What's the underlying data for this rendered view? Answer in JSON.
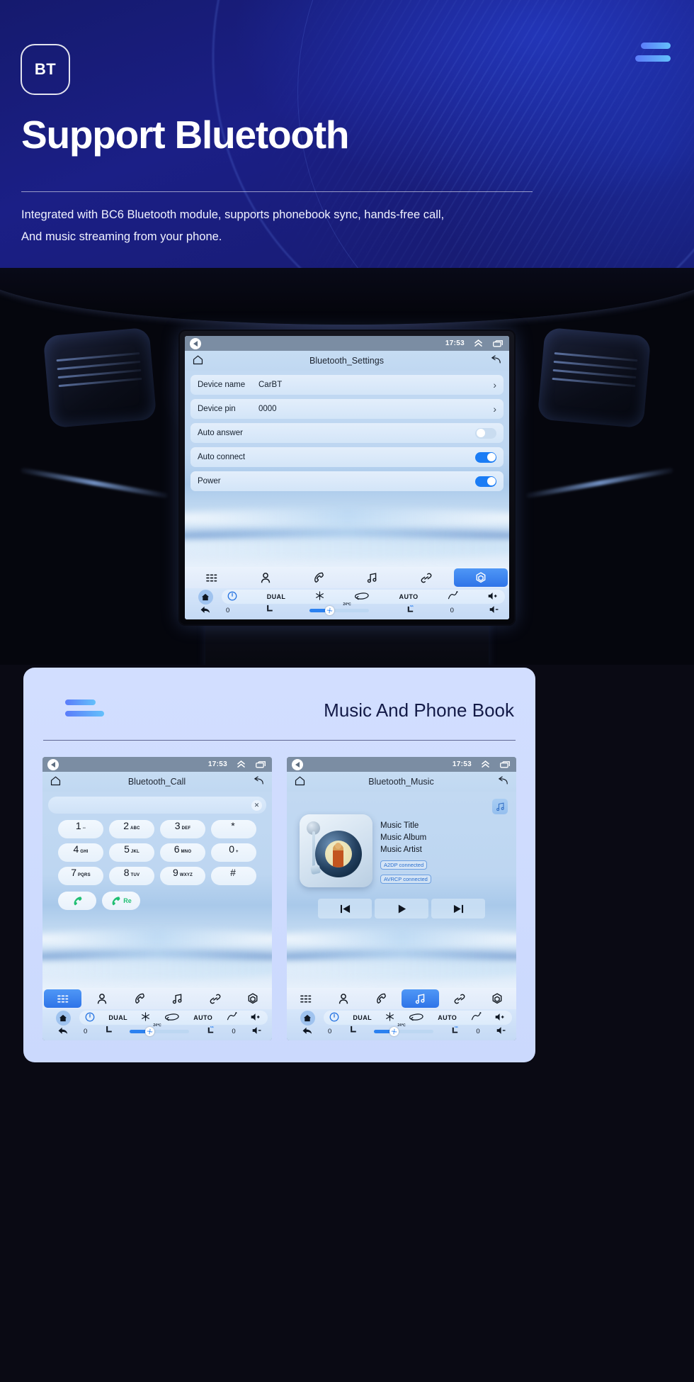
{
  "hero": {
    "badge": "BT",
    "title": "Support Bluetooth",
    "desc_line1": "Integrated with BC6 Bluetooth module, supports phonebook sync, hands-free call,",
    "desc_line2": "And music streaming from your phone.",
    "menu_icon": "hamburger-icon",
    "accent_start": "#5b7cfa",
    "accent_end": "#63c0fb"
  },
  "main_screen": {
    "statusbar": {
      "back_icon": "back-arrow-icon",
      "time": "17:53",
      "chevron_icon": "chevron-up-icon",
      "recents_icon": "recent-apps-icon"
    },
    "app_title": "Bluetooth_Settings",
    "home_icon": "home-icon",
    "back_icon": "undo-back-icon",
    "settings_rows": [
      {
        "label": "Device name",
        "value": "CarBT",
        "control": "chevron",
        "chevron": "›"
      },
      {
        "label": "Device pin",
        "value": "0000",
        "control": "chevron",
        "chevron": "›"
      },
      {
        "label": "Auto answer",
        "value": "",
        "control": "toggle",
        "state": "off"
      },
      {
        "label": "Auto connect",
        "value": "",
        "control": "toggle",
        "state": "on"
      },
      {
        "label": "Power",
        "value": "",
        "control": "toggle",
        "state": "on"
      }
    ],
    "nav": [
      {
        "name": "dialpad",
        "icon": "dialpad-icon",
        "active": false
      },
      {
        "name": "contacts",
        "icon": "person-icon",
        "active": false
      },
      {
        "name": "call",
        "icon": "phone-icon",
        "active": false
      },
      {
        "name": "music",
        "icon": "music-note-icon",
        "active": false
      },
      {
        "name": "link",
        "icon": "link-icon",
        "active": false
      },
      {
        "name": "settings",
        "icon": "settings-hexagon-icon",
        "active": true
      }
    ],
    "climate": {
      "power_icon": "power-icon",
      "dual": "DUAL",
      "snow_icon": "snowflake-icon",
      "recirc_icon": "recirculate-icon",
      "auto": "AUTO",
      "defrost_icon": "defrost-icon",
      "vol_up_icon": "volume-up-icon",
      "vol_down_icon": "volume-down-icon",
      "back_icon": "back-arrow-icon",
      "home_icon": "home-icon",
      "temp": "24℃",
      "left_temp": "0",
      "right_temp": "0",
      "seat_icon": "seat-icon",
      "seat_heat_icon": "seat-heat-icon",
      "fan_icon": "fan-icon",
      "fan_percent": 30
    }
  },
  "panel": {
    "title": "Music And Phone Book",
    "bars_icon": "menu-bars-icon"
  },
  "call_screen": {
    "statusbar": {
      "time": "17:53"
    },
    "app_title": "Bluetooth_Call",
    "input_value": "",
    "clear_icon": "clear-x-icon",
    "keys": [
      {
        "n": "1",
        "s": "--"
      },
      {
        "n": "2",
        "s": "ABC"
      },
      {
        "n": "3",
        "s": "DEF"
      },
      {
        "n": "*",
        "s": ""
      },
      {
        "n": "4",
        "s": "GHI"
      },
      {
        "n": "5",
        "s": "JKL"
      },
      {
        "n": "6",
        "s": "MNO"
      },
      {
        "n": "0",
        "s": "+"
      },
      {
        "n": "7",
        "s": "PQRS"
      },
      {
        "n": "8",
        "s": "TUV"
      },
      {
        "n": "9",
        "s": "WXYZ"
      },
      {
        "n": "#",
        "s": ""
      }
    ],
    "call_button_icon": "phone-call-icon",
    "redial_label": "Re",
    "nav_active": "dialpad"
  },
  "music_screen": {
    "statusbar": {
      "time": "17:53"
    },
    "app_title": "Bluetooth_Music",
    "playlist_icon": "music-list-icon",
    "album_art": "vinyl-turntable",
    "meta": {
      "title": "Music Title",
      "album": "Music Album",
      "artist": "Music Artist"
    },
    "badges": [
      "A2DP  connected",
      "AVRCP connected"
    ],
    "controls": [
      {
        "name": "previous",
        "icon": "skip-previous-icon"
      },
      {
        "name": "play",
        "icon": "play-icon"
      },
      {
        "name": "next",
        "icon": "skip-next-icon"
      }
    ],
    "nav_active": "music"
  }
}
